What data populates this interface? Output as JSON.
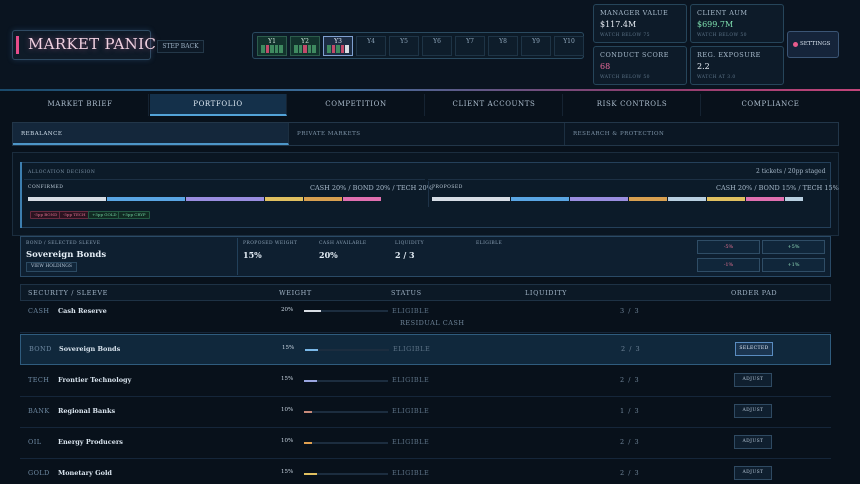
{
  "app": {
    "title": "MARKET PANIC",
    "step_back": "STEP BACK",
    "settings": "SETTINGS"
  },
  "years": [
    "Y1",
    "Y2",
    "Y3",
    "Y4",
    "Y5",
    "Y6",
    "Y7",
    "Y8",
    "Y9",
    "Y10"
  ],
  "kpis": [
    {
      "label": "MANAGER VALUE",
      "value": "$117.4M",
      "sub": "WATCH BELOW 75",
      "color": "#e8eef5"
    },
    {
      "label": "CLIENT AUM",
      "value": "$699.7M",
      "sub": "WATCH BELOW 50",
      "color": "#7fe0b0"
    },
    {
      "label": "CONDUCT SCORE",
      "value": "68",
      "sub": "WATCH BELOW 50",
      "color": "#e86a9a"
    },
    {
      "label": "REG. EXPOSURE",
      "value": "2.2",
      "sub": "WATCH AT 3.0",
      "color": "#e8eef5"
    }
  ],
  "tabs": [
    "MARKET BRIEF",
    "PORTFOLIO",
    "COMPETITION",
    "CLIENT ACCOUNTS",
    "RISK CONTROLS",
    "COMPLIANCE"
  ],
  "subtabs": [
    "REBALANCE",
    "PRIVATE MARKETS",
    "RESEARCH & PROTECTION"
  ],
  "allocation": {
    "label": "ALLOCATION DECISION",
    "staged": "2 tickets / 20pp staged",
    "confirmed_label": "CONFIRMED",
    "confirmed_summary": "CASH 20% / BOND 20% / TECH 20%",
    "proposed_label": "PROPOSED",
    "proposed_summary": "CASH 20% / BOND 15% / TECH 15%",
    "chips": [
      "-5pp BOND",
      "-5pp TECH",
      "+5pp GOLD",
      "+5pp CRYP"
    ]
  },
  "sleeve": {
    "label": "BOND / SELECTED SLEEVE",
    "name": "Sovereign Bonds",
    "view_holdings": "VIEW HOLDINGS",
    "proposed_weight_label": "PROPOSED WEIGHT",
    "proposed_weight": "15%",
    "cash_label": "CASH AVAILABLE",
    "cash": "20%",
    "liquidity_label": "LIQUIDITY",
    "liquidity": "2 / 3",
    "eligible_label": "ELIGIBLE",
    "buttons": [
      "-5%",
      "+5%",
      "-1%",
      "+1%"
    ]
  },
  "table": {
    "headers": [
      "SECURITY / SLEEVE",
      "WEIGHT",
      "STATUS",
      "LIQUIDITY",
      "ORDER PAD"
    ],
    "rows": [
      {
        "ticker": "CASH",
        "name": "Cash Reserve",
        "weight": "20%",
        "weight_frac": 0.2,
        "color": "#d8dde4",
        "status": "ELIGIBLE",
        "status2": "RESIDUAL CASH",
        "liquidity": "3 / 3",
        "action": ""
      },
      {
        "ticker": "BOND",
        "name": "Sovereign Bonds",
        "weight": "15%",
        "weight_frac": 0.15,
        "color": "#7ab8e8",
        "status": "ELIGIBLE",
        "status2": "",
        "liquidity": "2 / 3",
        "action": "SELECTED"
      },
      {
        "ticker": "TECH",
        "name": "Frontier Technology",
        "weight": "15%",
        "weight_frac": 0.15,
        "color": "#9aa6e0",
        "status": "ELIGIBLE",
        "status2": "",
        "liquidity": "2 / 3",
        "action": "ADJUST"
      },
      {
        "ticker": "BANK",
        "name": "Regional Banks",
        "weight": "10%",
        "weight_frac": 0.1,
        "color": "#c88a7a",
        "status": "ELIGIBLE",
        "status2": "",
        "liquidity": "1 / 3",
        "action": "ADJUST"
      },
      {
        "ticker": "OIL",
        "name": "Energy Producers",
        "weight": "10%",
        "weight_frac": 0.1,
        "color": "#e0a050",
        "status": "ELIGIBLE",
        "status2": "",
        "liquidity": "2 / 3",
        "action": "ADJUST"
      },
      {
        "ticker": "GOLD",
        "name": "Monetary Gold",
        "weight": "15%",
        "weight_frac": 0.15,
        "color": "#e0c060",
        "status": "ELIGIBLE",
        "status2": "",
        "liquidity": "2 / 3",
        "action": "ADJUST"
      }
    ]
  }
}
